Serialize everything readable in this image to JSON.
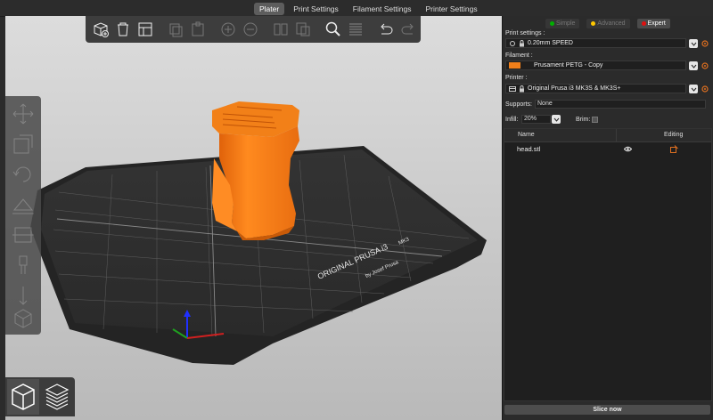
{
  "tabs": [
    "Plater",
    "Print Settings",
    "Filament Settings",
    "Printer Settings"
  ],
  "toolbar": {
    "icons": [
      "add-icon",
      "delete-icon",
      "delete-all-icon",
      "arrange-icon",
      "copy-icon",
      "paste-icon",
      "add-instance-icon",
      "remove-instance-icon",
      "split-objects-icon",
      "split-parts-icon",
      "search-icon",
      "layers-editing-icon",
      "undo-icon",
      "redo-icon"
    ]
  },
  "left_toolbar": {
    "icons": [
      "move-icon",
      "scale-icon",
      "rotate-icon",
      "place-on-face-icon",
      "cut-icon",
      "paint-supports-icon",
      "seam-paint-icon",
      "measure-icon"
    ]
  },
  "modes": {
    "simple": "Simple",
    "advanced": "Advanced",
    "expert": "Expert"
  },
  "mode_colors": {
    "simple": "#00b000",
    "advanced": "#ffc800",
    "expert": "#e01010"
  },
  "print_settings": {
    "label": "Print settings :",
    "value": "0.20mm SPEED"
  },
  "filament": {
    "label": "Filament :",
    "value": "Prusament PETG - Copy",
    "color": "#f07f1a"
  },
  "printer": {
    "label": "Printer :",
    "value": "Original Prusa i3 MK3S & MK3S+"
  },
  "supports": {
    "label": "Supports:",
    "value": "None"
  },
  "infill": {
    "label": "Infill:",
    "value": "20%"
  },
  "brim": {
    "label": "Brim:"
  },
  "object_list": {
    "col_name": "Name",
    "col_editing": "Editing",
    "items": [
      {
        "name": "head.stl"
      }
    ]
  },
  "slice_button": "Slice now",
  "bed": {
    "brand": "ORIGINAL PRUSA i3",
    "model": "MK3",
    "byline": "by Josef Prusa"
  }
}
